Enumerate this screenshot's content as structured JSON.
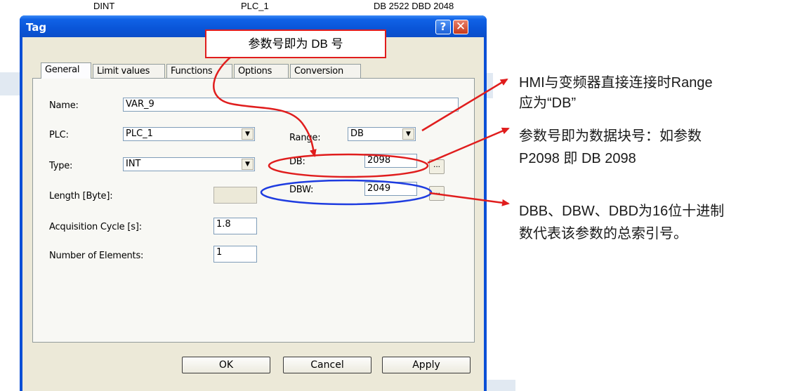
{
  "background_row": {
    "col1": "DINT",
    "col2": "PLC_1",
    "col3": "DB 2522 DBD 2048"
  },
  "window": {
    "title": "Tag",
    "help_glyph": "?",
    "close_glyph": "✕"
  },
  "tabs": [
    {
      "label": "General"
    },
    {
      "label": "Limit values"
    },
    {
      "label": "Functions"
    },
    {
      "label": "Options"
    },
    {
      "label": "Conversion"
    }
  ],
  "form": {
    "name_label": "Name:",
    "name_value": "VAR_9",
    "plc_label": "PLC:",
    "plc_value": "PLC_1",
    "type_label": "Type:",
    "type_value": "INT",
    "length_label": "Length [Byte]:",
    "length_value": "",
    "acq_label": "Acquisition Cycle [s]:",
    "acq_value": "1.8",
    "elements_label": "Number of Elements:",
    "elements_value": "1",
    "range_label": "Range:",
    "range_value": "DB",
    "db_label": "DB:",
    "db_value": "2098",
    "dbw_label": "DBW:",
    "dbw_value": "2049",
    "ellipsis": "..."
  },
  "buttons": {
    "ok": "OK",
    "cancel": "Cancel",
    "apply": "Apply"
  },
  "annotations": {
    "callout": "参数号即为 DB 号",
    "note1_line1": "HMI与变频器直接连接时Range",
    "note1_line2": "应为“DB”",
    "note2_line1": "参数号即为数据块号：如参数",
    "note2_line2": "P2098 即 DB 2098",
    "note3_line1": "DBB、DBW、DBD为16位十进制",
    "note3_line2": "数代表该参数的总索引号。"
  },
  "colors": {
    "title_bar": "#0b4fd6",
    "dialog_face": "#ece9d8",
    "annotation_red": "#e01d1d",
    "annotation_blue": "#1e3ce0"
  }
}
